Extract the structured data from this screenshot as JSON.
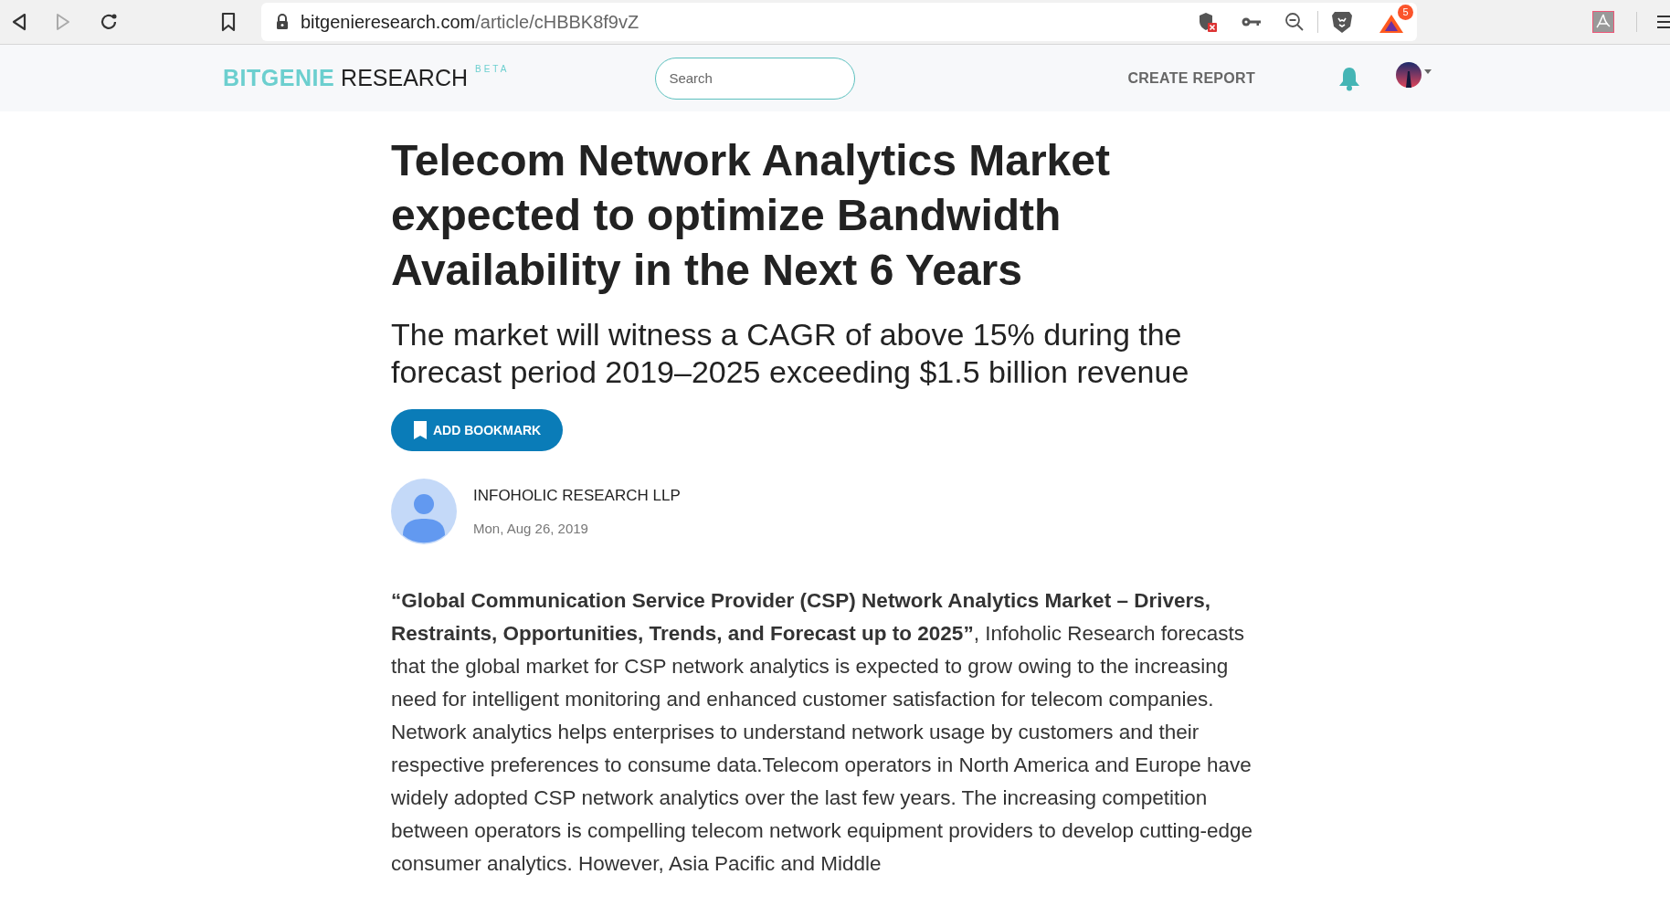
{
  "browser": {
    "url_domain": "bitgenieresearch.com",
    "url_path": "/article/cHBBK8f9vZ",
    "rewards_badge": "5"
  },
  "header": {
    "logo_primary": "BITGENIE",
    "logo_secondary": "RESEARCH",
    "logo_tag": "BETA",
    "search": {
      "placeholder": "Search"
    },
    "create_report": "CREATE REPORT"
  },
  "article": {
    "title": "Telecom Network Analytics Market expected to optimize Bandwidth Availability in the Next 6 Years",
    "subtitle": "The market will witness a CAGR of above 15% during the forecast period 2019–2025 exceeding $1.5 billion revenue",
    "bookmark_button": "ADD BOOKMARK",
    "author": "INFOHOLIC RESEARCH LLP",
    "date": "Mon, Aug 26, 2019",
    "body": "**“Global Communication Service Provider (CSP) Network Analytics Market – Drivers, Restraints, Opportunities, Trends, and Forecast up to 2025”**, Infoholic Research forecasts that the global market for CSP network analytics is expected to grow owing to the increasing need for intelligent monitoring and enhanced customer satisfaction for telecom companies. Network analytics helps enterprises to understand network usage by customers and their respective preferences to consume data.Telecom operators in North America and Europe have widely adopted CSP network analytics over the last few years. The increasing competition between operators is compelling telecom network equipment providers to develop cutting-edge consumer analytics. However, Asia Pacific and Middle"
  }
}
